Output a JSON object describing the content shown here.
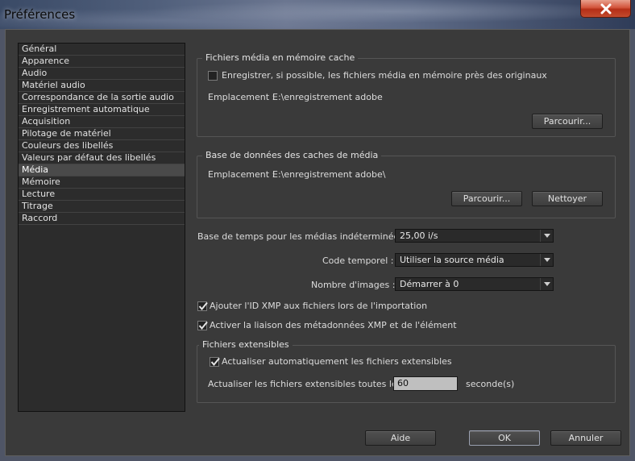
{
  "window": {
    "title": "Préférences",
    "close_icon": "close-icon"
  },
  "sidebar": {
    "items": [
      {
        "label": "Général"
      },
      {
        "label": "Apparence"
      },
      {
        "label": "Audio"
      },
      {
        "label": "Matériel audio"
      },
      {
        "label": "Correspondance de la sortie audio"
      },
      {
        "label": "Enregistrement automatique"
      },
      {
        "label": "Acquisition"
      },
      {
        "label": "Pilotage de matériel"
      },
      {
        "label": "Couleurs des libellés"
      },
      {
        "label": "Valeurs par défaut des libellés"
      },
      {
        "label": "Média"
      },
      {
        "label": "Mémoire"
      },
      {
        "label": "Lecture"
      },
      {
        "label": "Titrage"
      },
      {
        "label": "Raccord"
      }
    ],
    "selected": "Média"
  },
  "cache_media": {
    "title": "Fichiers média en mémoire cache",
    "checkbox_label": "Enregistrer, si possible, les fichiers média en mémoire près des originaux",
    "checked": false,
    "location_label": "Emplacement :",
    "location_value": "E:\\enregistrement adobe",
    "browse_label": "Parcourir..."
  },
  "cache_db": {
    "title": "Base de données des caches de média",
    "location_label": "Emplacement :",
    "location_value": "E:\\enregistrement adobe\\",
    "browse_label": "Parcourir...",
    "clean_label": "Nettoyer"
  },
  "settings": {
    "timebase_label": "Base de temps pour les médias indéterminée :",
    "timebase_value": "25,00 i/s",
    "timecode_label": "Code temporel :",
    "timecode_value": "Utiliser la source média",
    "frame_count_label": "Nombre d'images :",
    "frame_count_value": "Démarrer à 0",
    "xmp_id_label": "Ajouter l'ID XMP aux fichiers lors de l'importation",
    "xmp_id_checked": true,
    "xmp_link_label": "Activer la liaison des métadonnées XMP et de l'élément",
    "xmp_link_checked": true
  },
  "growing_files": {
    "title": "Fichiers extensibles",
    "auto_refresh_label": "Actualiser automatiquement les fichiers extensibles",
    "auto_refresh_checked": true,
    "interval_label": "Actualiser les fichiers extensibles toutes les",
    "interval_value": "60",
    "interval_unit": "seconde(s)"
  },
  "footer": {
    "help_label": "Aide",
    "ok_label": "OK",
    "cancel_label": "Annuler"
  }
}
